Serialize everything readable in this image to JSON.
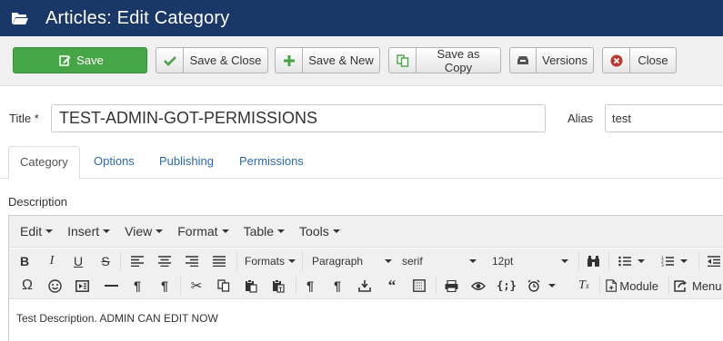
{
  "header": {
    "title": "Articles: Edit Category"
  },
  "toolbar": {
    "save": "Save",
    "save_close": "Save & Close",
    "save_new": "Save & New",
    "save_copy": "Save as Copy",
    "versions": "Versions",
    "close": "Close"
  },
  "form": {
    "title_label": "Title",
    "title_required": " *",
    "title_value": "TEST-ADMIN-GOT-PERMISSIONS",
    "alias_label": "Alias",
    "alias_value": "test"
  },
  "tabs": [
    "Category",
    "Options",
    "Publishing",
    "Permissions"
  ],
  "description_label": "Description",
  "editor": {
    "menus": [
      "Edit",
      "Insert",
      "View",
      "Format",
      "Table",
      "Tools"
    ],
    "formats_label": "Formats",
    "block_format": "Paragraph",
    "font_family": "serif",
    "font_size": "12pt",
    "module_label": "Module",
    "menu_label": "Menu",
    "content": "Test Description. ADMIN CAN EDIT NOW"
  },
  "colors": {
    "header_bg": "#1a3867",
    "save_green": "#46a546",
    "link_blue": "#2a69b8",
    "close_red": "#bd362f"
  }
}
